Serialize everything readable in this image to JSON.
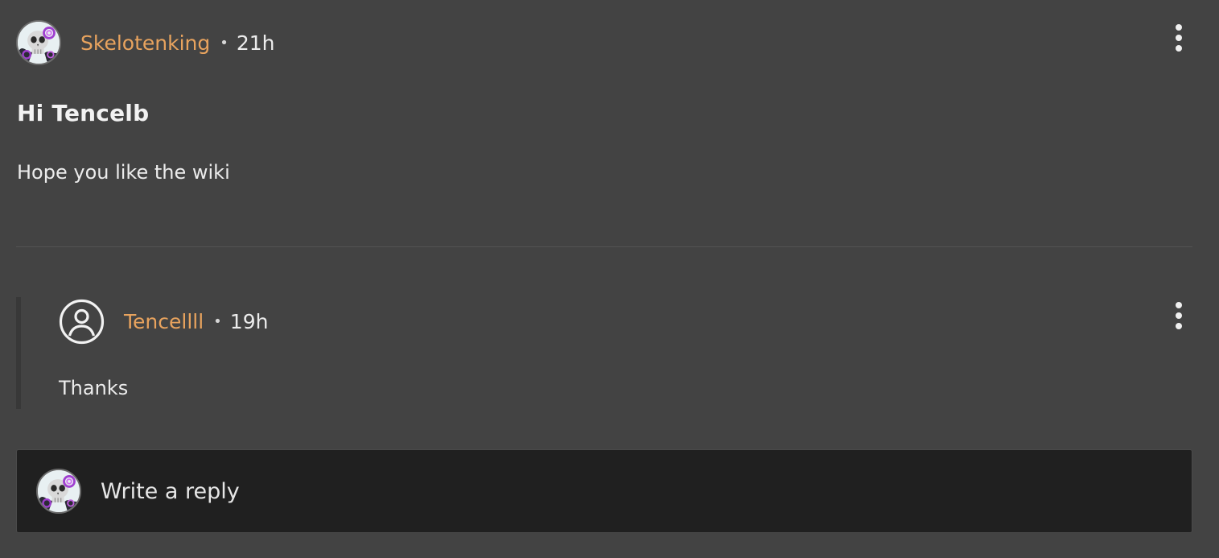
{
  "post": {
    "author": "Skelotenking",
    "separator": "•",
    "time": "21h",
    "title": "Hi Tencelb",
    "body": "Hope you like the wiki"
  },
  "reply": {
    "author": "Tencellll",
    "separator": "•",
    "time": "19h",
    "body": "Thanks"
  },
  "composer": {
    "placeholder": "Write a reply"
  },
  "colors": {
    "background": "#434343",
    "username": "#e8a35e",
    "composer_bg": "#202020"
  },
  "icons": {
    "post_menu": "more-vertical-icon",
    "reply_menu": "more-vertical-icon",
    "reply_avatar": "user-circle-icon"
  }
}
